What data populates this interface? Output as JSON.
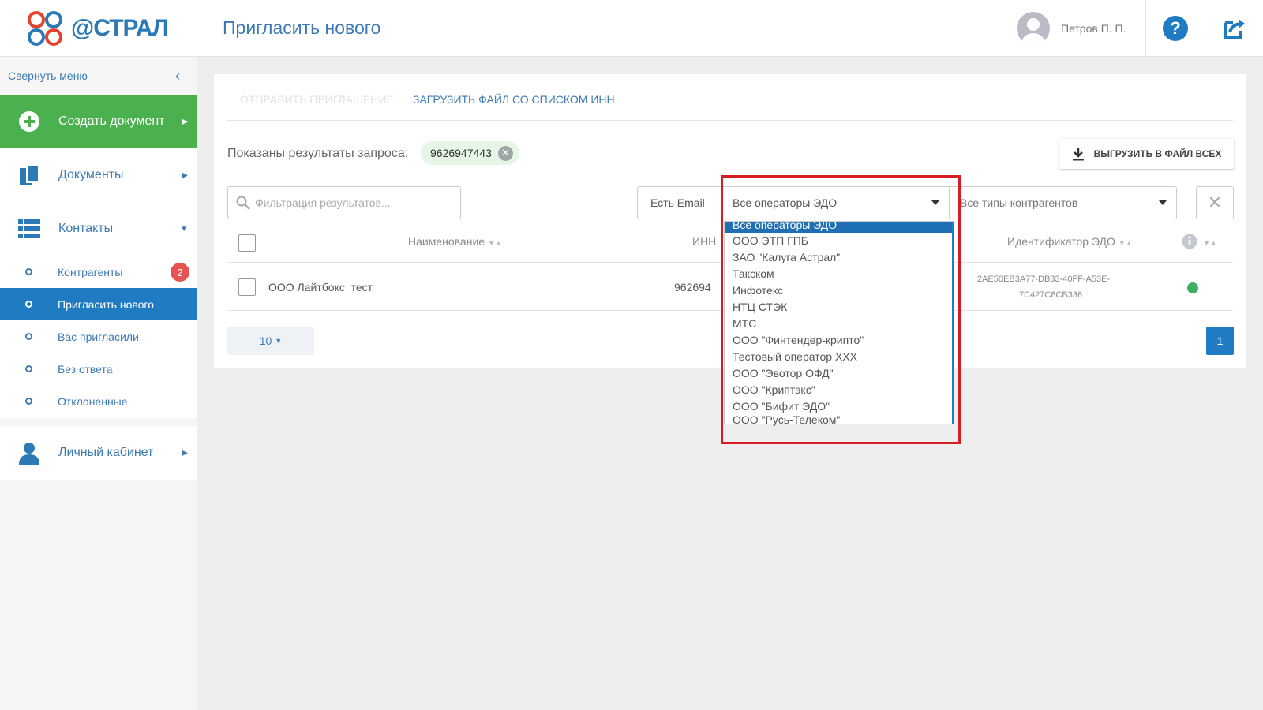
{
  "header": {
    "logo_text": "@СТРАЛ",
    "page_title": "Пригласить нового",
    "user_name": "Петров П. П.",
    "help_label": "?"
  },
  "sidebar": {
    "collapse_label": "Свернуть меню",
    "create_doc": "Создать документ",
    "documents": "Документы",
    "contacts": "Контакты",
    "cabinet": "Личный кабинет",
    "submenu": [
      {
        "label": "Контрагенты",
        "badge": "2"
      },
      {
        "label": "Пригласить нового",
        "active": true
      },
      {
        "label": "Вас пригласили"
      },
      {
        "label": "Без ответа"
      },
      {
        "label": "Отклоненные"
      }
    ]
  },
  "tabs": {
    "send_invite": "Отправить приглашение",
    "upload_inn": "Загрузить файл со списком ИНН"
  },
  "query": {
    "label": "Показаны результаты запроса:",
    "value": "9626947443"
  },
  "export_button": "ВЫГРУЗИТЬ В ФАЙЛ ВСЕХ",
  "filters": {
    "search_placeholder": "Фильтрация результатов...",
    "has_email": "Есть Email",
    "operators_selected": "Все операторы ЭДО",
    "types_selected": "Все типы контрагентов"
  },
  "table": {
    "headers": {
      "name": "Наименование",
      "inn": "ИНН",
      "edo_id": "Идентификатор ЭДО"
    },
    "rows": [
      {
        "name": "ООО Лайтбокс_тест_",
        "inn": "962694",
        "edo_id_line1": "2AE50EB3A77-DB33-40FF-A53E-",
        "edo_id_line2": "7C427C8CB336",
        "status_color": "#3fae63"
      }
    ]
  },
  "pagination": {
    "page_size": "10",
    "current_page": "1"
  },
  "dropdown_options": [
    "Все операторы ЭДО",
    "ООО ЭТП ГПБ",
    "ЗАО \"Калуга Астрал\"",
    "Такском",
    "Инфотекс",
    "НТЦ СТЭК",
    "МТС",
    "ООО \"Финтендер-крипто\"",
    "Тестовый оператор XXX",
    "ООО \"Эвотор ОФД\"",
    "ООО \"Криптэкс\"",
    "ООО \"Бифит ЭДО\"",
    "ООО \"Русь-Телеком\""
  ],
  "colors": {
    "accent": "#1f7cc3",
    "create_green": "#4bb04e",
    "badge_red": "#e55353",
    "highlight_red": "#d81c23"
  }
}
